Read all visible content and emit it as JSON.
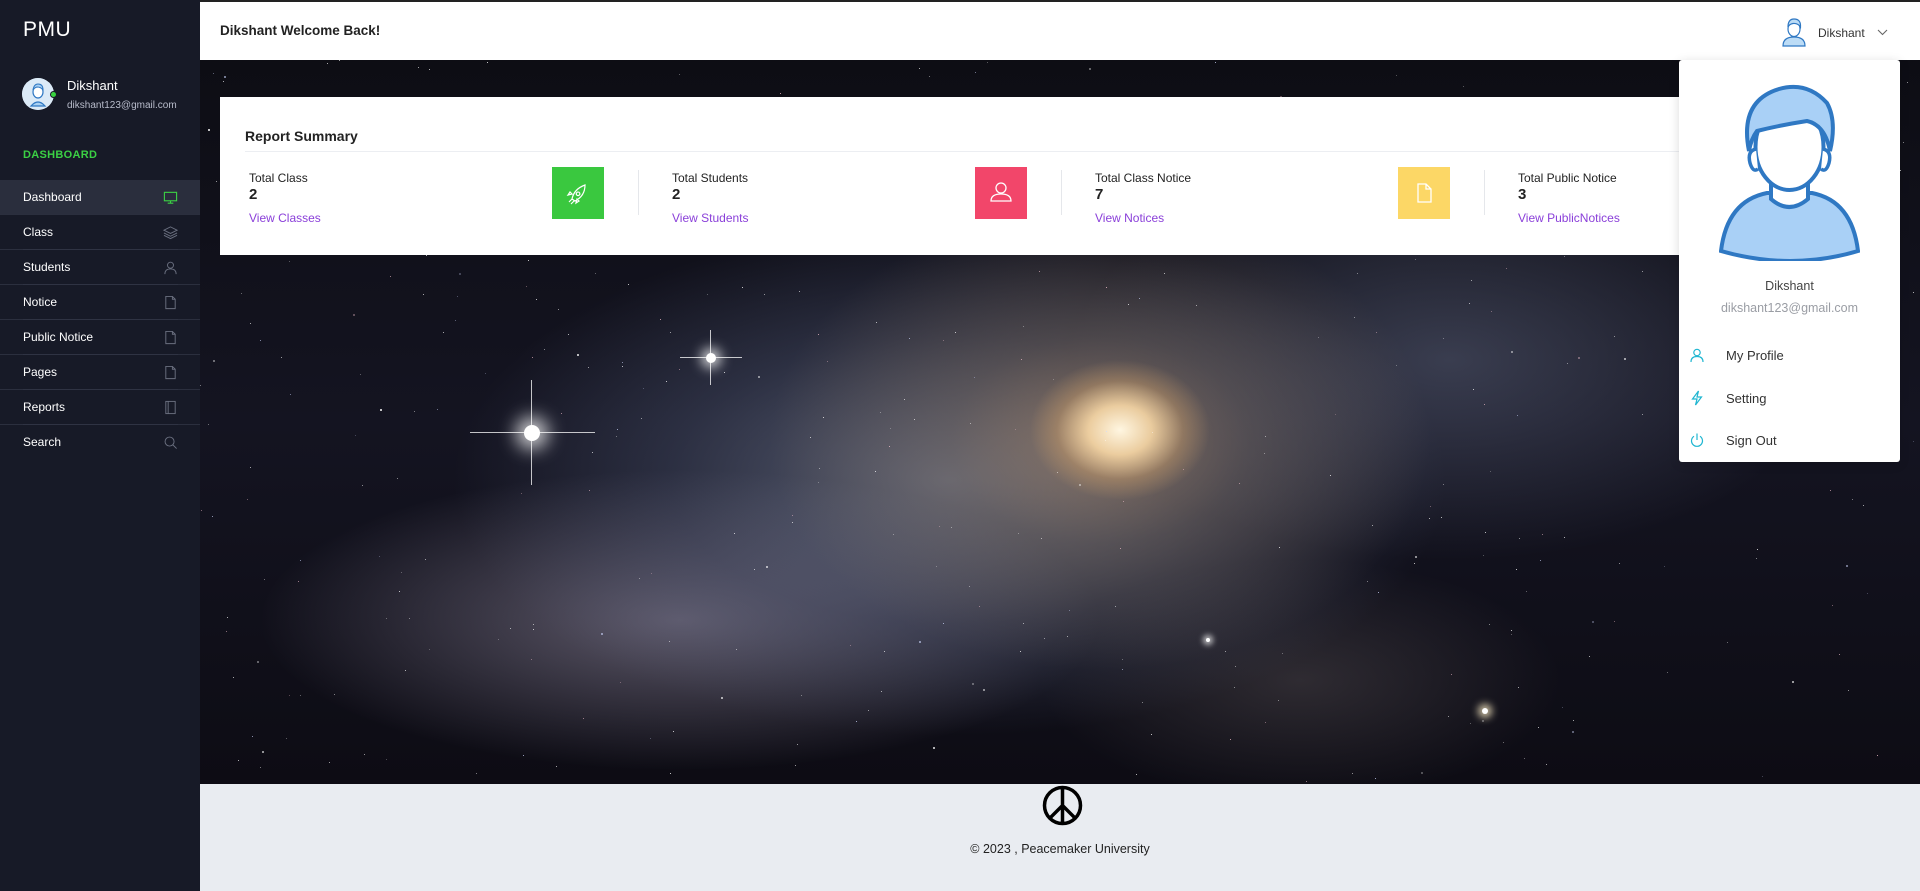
{
  "sidebar": {
    "brand": "PMU",
    "user": {
      "name": "Dikshant",
      "email": "dikshant123@gmail.com",
      "status_color": "#38d23f"
    },
    "section_label": "DASHBOARD",
    "items": [
      {
        "label": "Dashboard",
        "icon": "monitor-icon",
        "active": true
      },
      {
        "label": "Class",
        "icon": "layers-icon"
      },
      {
        "label": "Students",
        "icon": "user-icon"
      },
      {
        "label": "Notice",
        "icon": "document-icon"
      },
      {
        "label": "Public Notice",
        "icon": "document-icon"
      },
      {
        "label": "Pages",
        "icon": "document-icon"
      },
      {
        "label": "Reports",
        "icon": "book-icon"
      },
      {
        "label": "Search",
        "icon": "search-icon"
      }
    ]
  },
  "header": {
    "welcome": "Dikshant Welcome Back!",
    "user_name": "Dikshant"
  },
  "report": {
    "title": "Report Summary",
    "stats": [
      {
        "label": "Total Class",
        "value": "2",
        "link": "View Classes",
        "icon": "rocket-icon",
        "color": "#3ac83f"
      },
      {
        "label": "Total Students",
        "value": "2",
        "link": "View Students",
        "icon": "user-icon",
        "color": "#f2466a"
      },
      {
        "label": "Total Class Notice",
        "value": "7",
        "link": "View Notices",
        "icon": "document-icon",
        "color": "#fcd766"
      },
      {
        "label": "Total Public Notice",
        "value": "3",
        "link": "View PublicNotices",
        "icon": "document-icon",
        "color": "#6fa8f5"
      }
    ]
  },
  "dropdown": {
    "name": "Dikshant",
    "email": "dikshant123@gmail.com",
    "items": [
      {
        "label": "My Profile",
        "icon": "user-icon"
      },
      {
        "label": "Setting",
        "icon": "lightning-icon"
      },
      {
        "label": "Sign Out",
        "icon": "power-icon"
      }
    ],
    "accent_color": "#1fb6d1"
  },
  "footer": {
    "copyright": "© 2023 , Peacemaker University",
    "logo_icon": "peace-icon"
  }
}
